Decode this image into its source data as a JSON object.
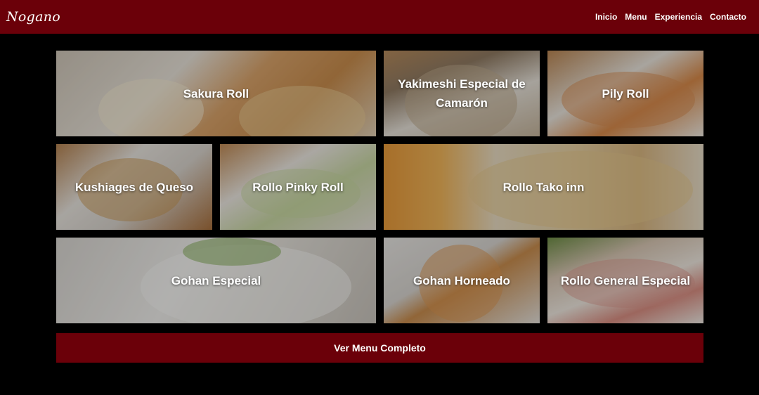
{
  "brand": "Nogano",
  "nav": [
    "Inicio",
    "Menu",
    "Experiencia",
    "Contacto"
  ],
  "dishes": [
    "Sakura Roll",
    "Yakimeshi Especial de Camarón",
    "Pily Roll",
    "Kushiages de Queso",
    "Rollo Pinky Roll",
    "Rollo Tako inn",
    "Gohan Especial",
    "Gohan Horneado",
    "Rollo General Especial"
  ],
  "cta_label": "Ver Menu Completo",
  "colors": {
    "brand_red": "#6b0009",
    "background": "#000000"
  }
}
